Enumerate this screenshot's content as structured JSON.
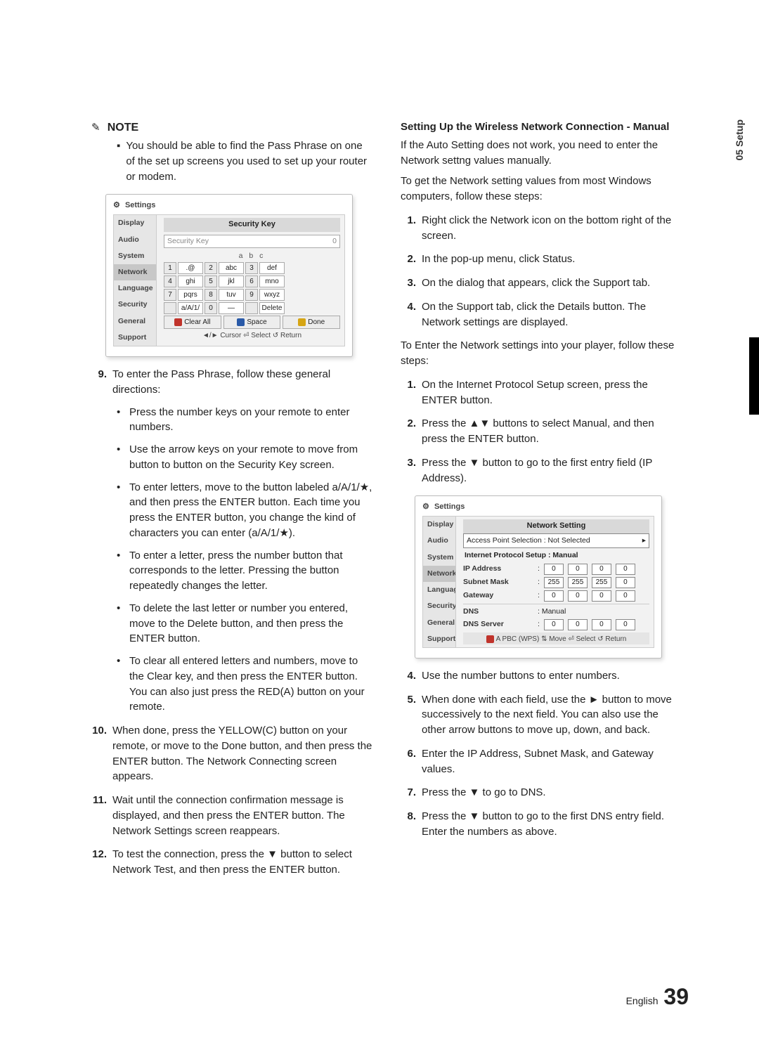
{
  "note": {
    "heading": "NOTE",
    "icon": "✎",
    "item": "You should be able to find the Pass Phrase on one of the set up screens you used to set up your router or modem."
  },
  "osd1": {
    "settings_label": "Settings",
    "side": [
      "Display",
      "Audio",
      "System",
      "Network",
      "Language",
      "Security",
      "General",
      "Support"
    ],
    "title": "Security Key",
    "placeholder": "Security Key",
    "counter": "0",
    "abc_row": "a  b  c",
    "keys": [
      [
        "1",
        ".@",
        "2",
        "abc",
        "3",
        "def"
      ],
      [
        "4",
        "ghi",
        "5",
        "jkl",
        "6",
        "mno"
      ],
      [
        "7",
        "pqrs",
        "8",
        "tuv",
        "9",
        "wxyz"
      ],
      [
        "",
        "a/A/1/★",
        "0",
        "—",
        "",
        "Delete"
      ]
    ],
    "actions": {
      "clear": "Clear All",
      "space": "Space",
      "done": "Done"
    },
    "help": "◄/► Cursor    ⏎ Select    ↺ Return"
  },
  "left_list": {
    "i9": {
      "num": "9.",
      "text": "To enter the Pass Phrase, follow these general directions:",
      "subs": [
        "Press the number keys on your remote to enter numbers.",
        "Use the arrow keys on your remote to move from button to button on the Security Key screen.",
        "To enter letters, move to the button labeled a/A/1/★, and then press the ENTER button. Each time you press the ENTER button, you change the kind of characters you can enter (a/A/1/★).",
        "To enter a letter, press the number button that corresponds to the letter. Pressing the button repeatedly changes the letter.",
        "To delete the last letter or number you entered, move to the Delete button, and then press the ENTER button.",
        "To clear all entered letters and numbers, move to the Clear key, and then press the ENTER button. You can also just press the RED(A) button on your remote."
      ]
    },
    "i10": {
      "num": "10.",
      "text": "When done, press the YELLOW(C) button on your remote, or move to the Done button, and then press the ENTER button. The Network Connecting screen appears."
    },
    "i11": {
      "num": "11.",
      "text": "Wait until the connection confirmation message is displayed, and then press the ENTER button. The Network Settings screen reappears."
    },
    "i12": {
      "num": "12.",
      "text": "To test the connection, press the ▼ button to select Network Test, and then press the ENTER button."
    }
  },
  "right": {
    "h2": "Setting Up the Wireless Network Connection - Manual",
    "p1": "If the Auto Setting does not work, you need to enter the Network settng values manually.",
    "p2": "To get the Network setting values from most Windows computers, follow these steps:",
    "listA": [
      {
        "n": "1.",
        "t": "Right click the Network icon on the bottom right of the screen."
      },
      {
        "n": "2.",
        "t": "In the pop-up menu, click Status."
      },
      {
        "n": "3.",
        "t": "On the dialog that appears, click the Support tab."
      },
      {
        "n": "4.",
        "t": "On the Support tab, click the Details button. The Network settings are displayed."
      }
    ],
    "p3": "To Enter the Network settings into your player, follow these steps:",
    "listB": [
      {
        "n": "1.",
        "t": "On the Internet Protocol Setup screen, press the ENTER button."
      },
      {
        "n": "2.",
        "t": "Press the ▲▼ buttons to select Manual, and then press the ENTER button."
      },
      {
        "n": "3.",
        "t": "Press the ▼ button to go to the first entry field (IP Address)."
      }
    ],
    "listC": [
      {
        "n": "4.",
        "t": "Use the number buttons to enter numbers."
      },
      {
        "n": "5.",
        "t": "When done with each field, use the ► button to move successively to the next field. You can also use the other arrow buttons to move up, down, and back."
      },
      {
        "n": "6.",
        "t": "Enter the IP Address, Subnet Mask, and Gateway values."
      },
      {
        "n": "7.",
        "t": "Press the ▼ to go to DNS."
      },
      {
        "n": "8.",
        "t": "Press the ▼ button to go to the first DNS entry field. Enter the numbers as above."
      }
    ]
  },
  "osd2": {
    "settings_label": "Settings",
    "side": [
      "Display",
      "Audio",
      "System",
      "Network",
      "Language",
      "Security",
      "General",
      "Support"
    ],
    "title": "Network Setting",
    "ap_label": "Access Point Selection  :  Not Selected",
    "ips_label": "Internet Protocol Setup  :  Manual",
    "rows": {
      "ip": {
        "label": "IP Address",
        "v": [
          "0",
          "0",
          "0",
          "0"
        ]
      },
      "sm": {
        "label": "Subnet Mask",
        "v": [
          "255",
          "255",
          "255",
          "0"
        ]
      },
      "gw": {
        "label": "Gateway",
        "v": [
          "0",
          "0",
          "0",
          "0"
        ]
      },
      "dns": {
        "label": "DNS",
        "val": ": Manual"
      },
      "dnss": {
        "label": "DNS Server",
        "v": [
          "0",
          "0",
          "0",
          "0"
        ]
      }
    },
    "help": "A PBC (WPS)   ⇅ Move   ⏎ Select   ↺ Return"
  },
  "footer": {
    "lang": "English",
    "page": "39"
  },
  "tab": "05   Setup"
}
